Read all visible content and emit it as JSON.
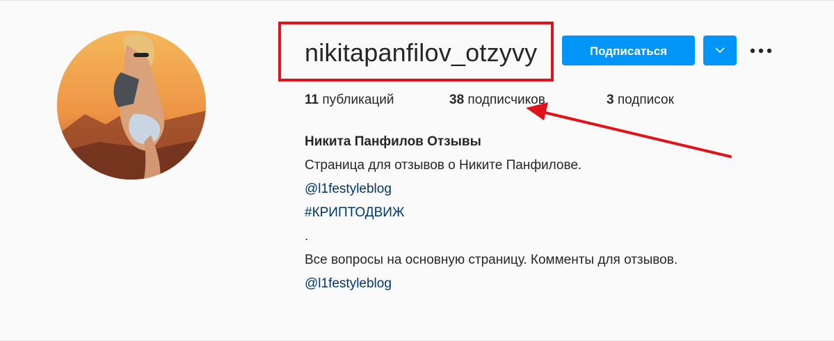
{
  "profile": {
    "username": "nikitapanfilov_otzyvy",
    "follow_label": "Подписаться",
    "stats": {
      "posts_count": "11",
      "posts_label": "публикаций",
      "followers_count": "38",
      "followers_label": "подписчиков",
      "following_count": "3",
      "following_label": "подписок"
    },
    "bio": {
      "full_name": "Никита Панфилов Отзывы",
      "line1": "Страница для отзывов о Никите Панфилове.",
      "mention1": "@l1festyleblog",
      "hashtag": "#КРИПТОДВИЖ",
      "dot": ".",
      "line2": "Все вопросы на основную страницу. Комменты для отзывов.",
      "mention2": "@l1festyleblog"
    }
  },
  "icons": {
    "dropdown": "chevron-down-icon",
    "more": "more-dots-icon"
  },
  "colors": {
    "accent": "#0095f6",
    "annotation": "#e0131b",
    "link": "#00376b",
    "background": "#fafafa"
  }
}
